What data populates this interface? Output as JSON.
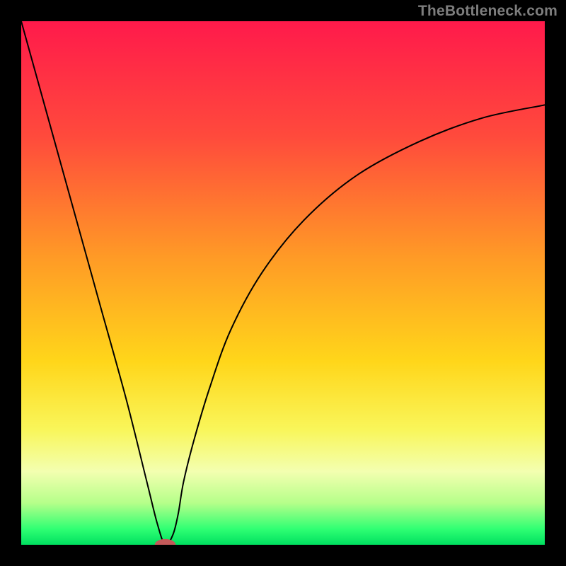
{
  "watermark_text": "TheBottleneck.com",
  "chart_data": {
    "type": "line",
    "title": "",
    "xlabel": "",
    "ylabel": "",
    "xlim": [
      0,
      100
    ],
    "ylim": [
      0,
      100
    ],
    "gradient_stops": [
      {
        "offset": 0,
        "color": "#ff1a4b"
      },
      {
        "offset": 22,
        "color": "#ff4a3c"
      },
      {
        "offset": 45,
        "color": "#ff9a26"
      },
      {
        "offset": 65,
        "color": "#ffd61a"
      },
      {
        "offset": 78,
        "color": "#f9f65a"
      },
      {
        "offset": 86,
        "color": "#f3ffb0"
      },
      {
        "offset": 92,
        "color": "#b6ff8a"
      },
      {
        "offset": 97,
        "color": "#2fff73"
      },
      {
        "offset": 100,
        "color": "#00e060"
      }
    ],
    "series": [
      {
        "name": "bottleneck-curve",
        "x": [
          0,
          5,
          10,
          15,
          20,
          24,
          26,
          27.5,
          29,
          30,
          31,
          33,
          36,
          40,
          46,
          54,
          64,
          76,
          88,
          100
        ],
        "values": [
          100,
          82,
          64,
          46,
          28,
          12,
          4,
          0,
          2,
          6,
          12,
          20,
          30,
          41,
          52,
          62,
          70.5,
          77,
          81.5,
          84
        ]
      }
    ],
    "marker": {
      "x": 27.5,
      "y": 0,
      "rx": 2.0,
      "ry": 1.1,
      "color": "#c45a5a"
    }
  }
}
